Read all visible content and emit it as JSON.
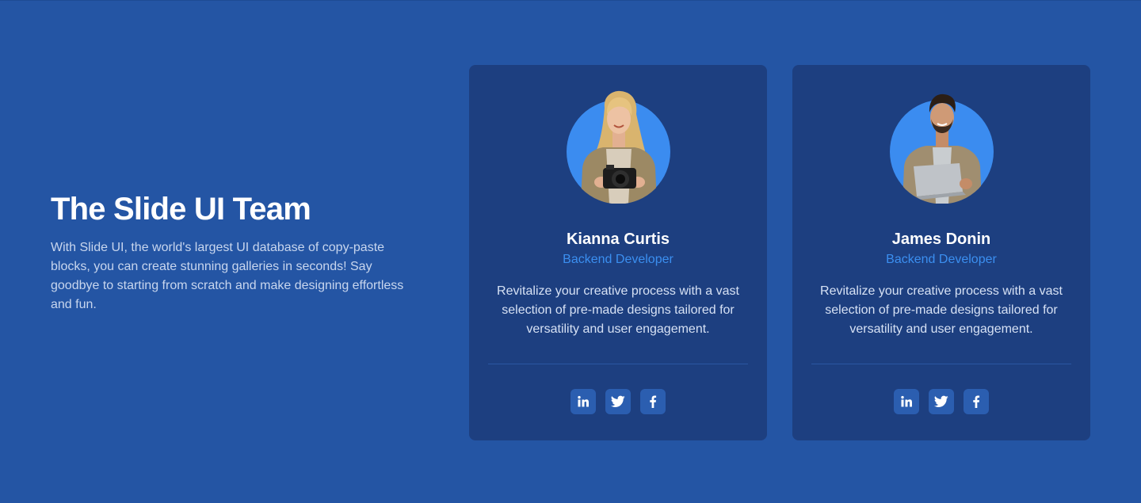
{
  "intro": {
    "title": "The Slide UI Team",
    "description": "With Slide UI, the world's largest UI database of copy-paste blocks, you can create stunning galleries in seconds! Say goodbye to starting from scratch and make designing effortless and fun."
  },
  "team": [
    {
      "name": "Kianna Curtis",
      "role": "Backend Developer",
      "bio": "Revitalize your creative process with a vast selection of pre-made designs tailored for versatility and user engagement.",
      "avatar_icon": "woman-with-camera-photo",
      "socials": [
        "linkedin-icon",
        "twitter-icon",
        "facebook-icon"
      ]
    },
    {
      "name": "James Donin",
      "role": "Backend Developer",
      "bio": "Revitalize your creative process with a vast selection of pre-made designs tailored for versatility and user engagement.",
      "avatar_icon": "man-with-laptop-photo",
      "socials": [
        "linkedin-icon",
        "twitter-icon",
        "facebook-icon"
      ]
    }
  ],
  "colors": {
    "background": "#2455a4",
    "card": "#1d3f80",
    "accent": "#3b8ff0",
    "social_button": "#2b5eb0"
  }
}
